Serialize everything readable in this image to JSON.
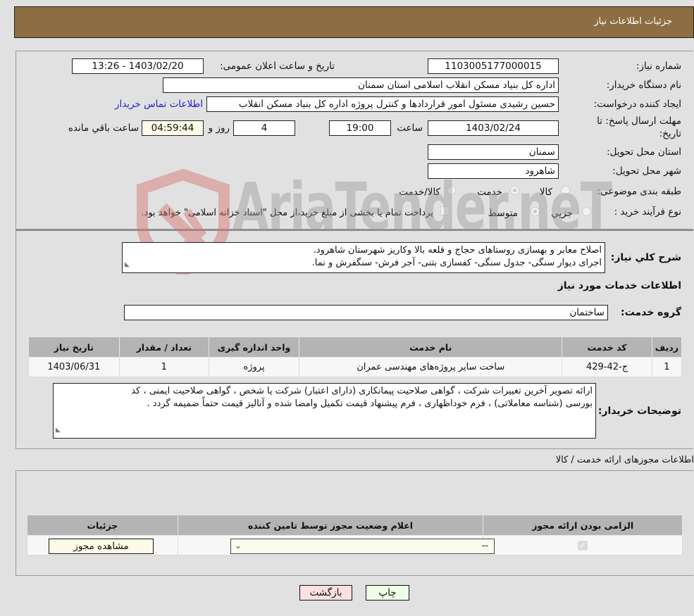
{
  "header": {
    "title": "جزئیات اطلاعات نیاز"
  },
  "form": {
    "need_number": {
      "label": "شماره نیاز:",
      "value": "1103005177000015"
    },
    "announce_datetime": {
      "label": "تاریخ و ساعت اعلان عمومی:",
      "value": "1403/02/20 - 13:26"
    },
    "buyer_org": {
      "label": "نام دستگاه خریدار:",
      "value": "اداره کل بنیاد مسکن انقلاب اسلامی استان سمنان"
    },
    "requester": {
      "label": "ایجاد کننده درخواست:",
      "value": "حسین رشیدی مسئول امور قراردادها و کنترل پروژه اداره کل بنیاد مسکن انقلاب",
      "contact_link": "اطلاعات تماس خریدار"
    },
    "deadline": {
      "label_line1": "مهلت ارسال پاسخ: تا",
      "label_line2": "تاریخ:",
      "date": "1403/02/24",
      "time_label": "ساعت",
      "time": "19:00",
      "days": "4",
      "days_label": "روز و",
      "remaining": "04:59:44",
      "remaining_label": "ساعت باقي مانده"
    },
    "province": {
      "label": "استان محل تحویل:",
      "value": "سمنان"
    },
    "city": {
      "label": "شهر محل تحویل:",
      "value": "شاهرود"
    },
    "category": {
      "label": "طبقه بندی موضوعی:",
      "options": [
        "کالا",
        "خدمت",
        "کالا/خدمت"
      ],
      "selected": "خدمت"
    },
    "purchase_type": {
      "label": "نوع فرآیند خرید :",
      "options": [
        "جزیي",
        "متوسط"
      ],
      "selected": "متوسط",
      "treasury_checkbox_label": "پرداخت تمام یا بخشی از مبلغ خرید،از محل \"اسناد خزانه اسلامی\" خواهد بود.",
      "treasury_checked": false
    }
  },
  "summary": {
    "label": "شرح کلي نیاز:",
    "lines": [
      "اصلاح معابر و بهسازی روستاهای حجاج و قلعه بالا وکاریز شهرستان شاهرود.",
      "اجرای دیوار سنگی- جدول سنگی- کفسازی بتنی- آجر فرش- سنگفرش و نما."
    ]
  },
  "services": {
    "section_title": "اطلاعات خدمات مورد نیاز",
    "group_label": "گروه خدمت:",
    "group_value": "ساختمان",
    "table": {
      "headers": [
        "ردیف",
        "کد خدمت",
        "نام خدمت",
        "واحد اندازه گیری",
        "تعداد / مقدار",
        "تاریخ نیاز"
      ],
      "rows": [
        [
          "1",
          "ج-42-429",
          "ساخت سایر پروژه‌های مهندسی عمران",
          "پروژه",
          "1",
          "1403/06/31"
        ]
      ]
    }
  },
  "buyer_notes": {
    "label": "توضیحات خریدار:",
    "lines": [
      "ارائه تصویر آخرین تغییرات شرکت ، گواهی صلاحیت پیمانکاری (دارای اعتبار) شرکت یا شخص ، گواهی صلاحیت ایمنی ، کد",
      "بورسی (شناسه معاملاتی) ، فرم خوداظهاری ، فرم پیشنهاد قیمت تکمیل وامضا شده و آنالیز قیمت حتماً ضمیمه گردد ."
    ]
  },
  "permits": {
    "section_title": "اطلاعات مجوزهای ارائه خدمت / کالا",
    "headers": [
      "الزامی بودن ارائه مجوز",
      "اعلام وضعیت مجوز توسط تامین کننده",
      "جزئیات"
    ],
    "row": {
      "required_checked": true,
      "status_selected": "--",
      "details_button": "مشاهده مجوز"
    }
  },
  "footer": {
    "print_button": "چاپ",
    "back_button": "بازگشت"
  },
  "watermark": {
    "text": "AriaTender.neT"
  },
  "colors": {
    "header_bg": "#8e6d42",
    "link": "#2020c8",
    "print_bg": "#eefee8",
    "back_bg": "#fde0e0",
    "cream": "#fdfbe8"
  }
}
